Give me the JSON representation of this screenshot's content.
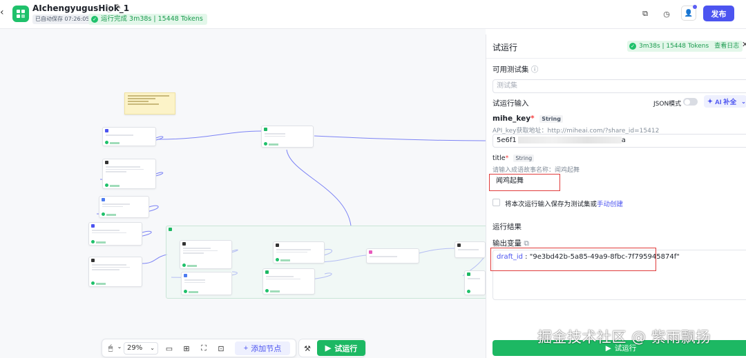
{
  "header": {
    "back_icon": "chevron-left-icon",
    "app_title": "AIchengyugusHiok_1",
    "autosave": "已自动保存 07:26:05",
    "run_status": "运行完成 3m38s | 15448 Tokens",
    "publish": "发布"
  },
  "canvas": {
    "zoom": "29%",
    "add_node": "添加节点",
    "run": "试运行"
  },
  "panel": {
    "title": "试运行",
    "badge": "3m38s | 15448 Tokens",
    "view_log": "查看日志",
    "testset_label": "可用测试集",
    "testset_placeholder": "测试集",
    "input_label": "试运行输入",
    "json_mode": "JSON模式",
    "ai_fill": "AI 补全",
    "fields": [
      {
        "name": "mihe_key",
        "type": "String",
        "desc": "API_key获取地址：http://miheai.com/?share_id=15412",
        "value_prefix": "5e6f1",
        "value_suffix": "a"
      },
      {
        "name": "title",
        "type": "String",
        "desc": "请输入成语故事名称：闻鸡起舞",
        "value": "闻鸡起舞"
      }
    ],
    "save_checkbox": "将本次运行输入保存为测试集或",
    "manual_create": "手动创建",
    "result_label": "运行结果",
    "output_label": "输出变量",
    "output_key": "draft_id",
    "output_value": "\"9e3bd42b-5a85-49a9-8fbc-7f795945874f\"",
    "run": "试运行"
  },
  "watermark": "掘金技术社区 @ 紫雨飘扬"
}
